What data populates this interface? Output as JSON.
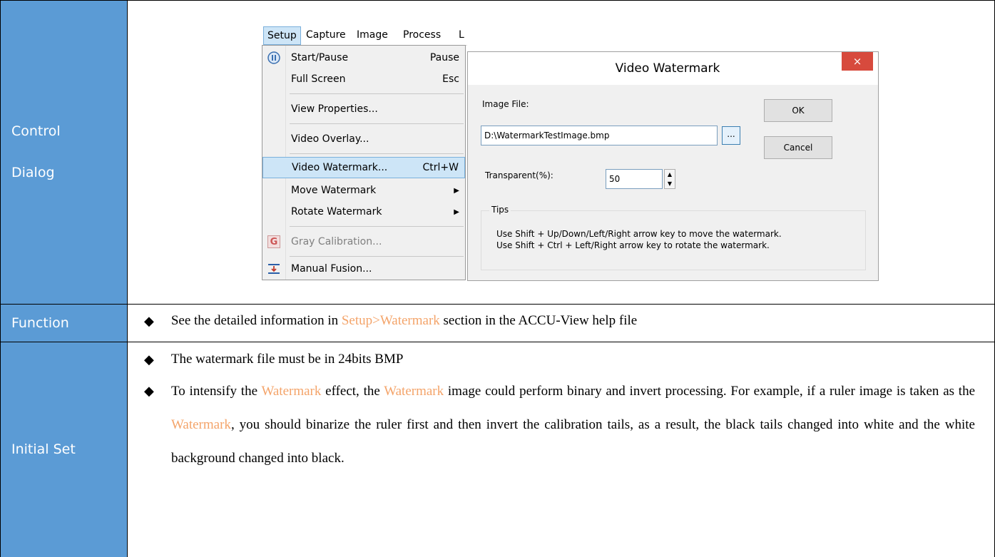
{
  "rows": {
    "control_dialog": {
      "label_line1": "Control",
      "label_line2": "Dialog"
    },
    "function": {
      "label": "Function",
      "text_before": "See the detailed information in ",
      "highlight": "Setup>Watermark",
      "text_after": " section in the ACCU-View help file"
    },
    "initial_set": {
      "label": "Initial Set",
      "bullet1": "The watermark file must be in 24bits BMP",
      "p_1": "To intensify the ",
      "p_hl1": "Watermark",
      "p_2": " effect, the ",
      "p_hl2": "Watermark",
      "p_3": " image could perform binary and invert processing. For example, if a ruler image is taken as the ",
      "p_hl3": "Watermark",
      "p_4": ", you should binarize the ruler first and then invert the calibration tails, as a result, the black tails changed into white and the white background changed into black."
    }
  },
  "menubar": {
    "items": [
      "Setup",
      "Capture",
      "Image",
      "Process",
      "L"
    ]
  },
  "menu": {
    "start_pause": "Start/Pause",
    "start_pause_sc": "Pause",
    "full_screen": "Full Screen",
    "full_screen_sc": "Esc",
    "view_properties": "View Properties...",
    "video_overlay": "Video Overlay...",
    "video_watermark": "Video Watermark...",
    "video_watermark_sc": "Ctrl+W",
    "move_watermark": "Move Watermark",
    "rotate_watermark": "Rotate Watermark",
    "gray_calibration": "Gray Calibration...",
    "gray_icon_letter": "G",
    "manual_fusion": "Manual Fusion..."
  },
  "dialog": {
    "title": "Video Watermark",
    "close": "×",
    "image_file_label": "Image File:",
    "image_file_value": "D:\\WatermarkTestImage.bmp",
    "browse": "...",
    "ok": "OK",
    "cancel": "Cancel",
    "transparent_label": "Transparent(%):",
    "transparent_value": "50",
    "tips_label": "Tips",
    "tip1": "Use Shift + Up/Down/Left/Right arrow key to move the watermark.",
    "tip2": "Use Shift + Ctrl + Left/Right arrow key to rotate the watermark."
  }
}
